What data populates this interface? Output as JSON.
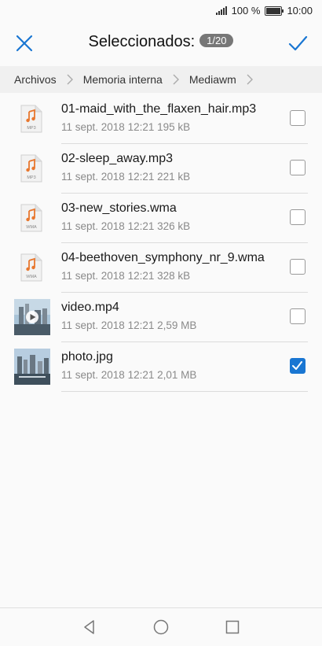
{
  "status": {
    "battery": "100 %",
    "time": "10:00"
  },
  "header": {
    "title": "Seleccionados:",
    "count": "1/20"
  },
  "breadcrumb": [
    "Archivos",
    "Memoria interna",
    "Mediawm"
  ],
  "files": [
    {
      "name": "01-maid_with_the_flaxen_hair.mp3",
      "meta": "11 sept. 2018 12:21 195 kB",
      "type": "MP3",
      "icon": "music-file-icon",
      "checked": false
    },
    {
      "name": "02-sleep_away.mp3",
      "meta": "11 sept. 2018 12:21 221 kB",
      "type": "MP3",
      "icon": "music-file-icon",
      "checked": false
    },
    {
      "name": "03-new_stories.wma",
      "meta": "11 sept. 2018 12:21 326 kB",
      "type": "WMA",
      "icon": "music-file-icon",
      "checked": false
    },
    {
      "name": "04-beethoven_symphony_nr_9.wma",
      "meta": "11 sept. 2018 12:21 328 kB",
      "type": "WMA",
      "icon": "music-file-icon",
      "checked": false
    },
    {
      "name": "video.mp4",
      "meta": "11 sept. 2018 12:21 2,59 MB",
      "icon": "video-thumbnail",
      "checked": false
    },
    {
      "name": "photo.jpg",
      "meta": "11 sept. 2018 12:21 2,01 MB",
      "icon": "photo-thumbnail",
      "checked": true
    }
  ],
  "colors": {
    "accent": "#1976d2",
    "music_icon": "#e8772e"
  }
}
